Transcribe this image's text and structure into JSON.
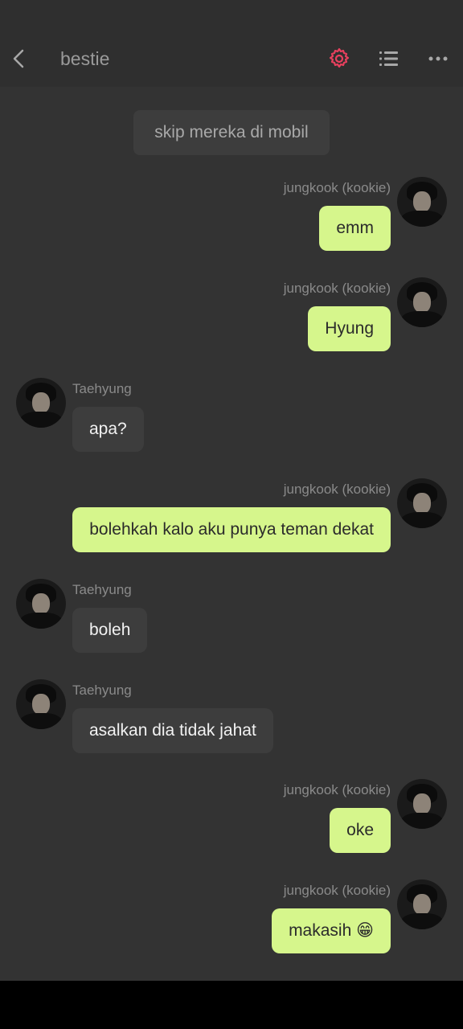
{
  "header": {
    "title": "bestie",
    "settings_icon_color": "#e8405e",
    "back_icon": "chevron-left-icon",
    "settings_icon": "gear-icon",
    "list_icon": "list-icon",
    "more_icon": "more-horizontal-icon"
  },
  "system_message": "skip mereka di mobil",
  "messages": [
    {
      "side": "right",
      "sender": "jungkook (kookie)",
      "text": "emm"
    },
    {
      "side": "right",
      "sender": "jungkook (kookie)",
      "text": "Hyung"
    },
    {
      "side": "left",
      "sender": "Taehyung",
      "text": "apa?"
    },
    {
      "side": "right",
      "sender": "jungkook (kookie)",
      "text": "bolehkah kalo aku punya teman dekat"
    },
    {
      "side": "left",
      "sender": "Taehyung",
      "text": "boleh"
    },
    {
      "side": "left",
      "sender": "Taehyung",
      "text": "asalkan dia tidak jahat"
    },
    {
      "side": "right",
      "sender": "jungkook (kookie)",
      "text": "oke"
    },
    {
      "side": "right",
      "sender": "jungkook (kookie)",
      "text": "makasih 😁"
    }
  ],
  "colors": {
    "background": "#333333",
    "own_bubble": "#d6f68c",
    "other_bubble": "#3d3d3d"
  }
}
